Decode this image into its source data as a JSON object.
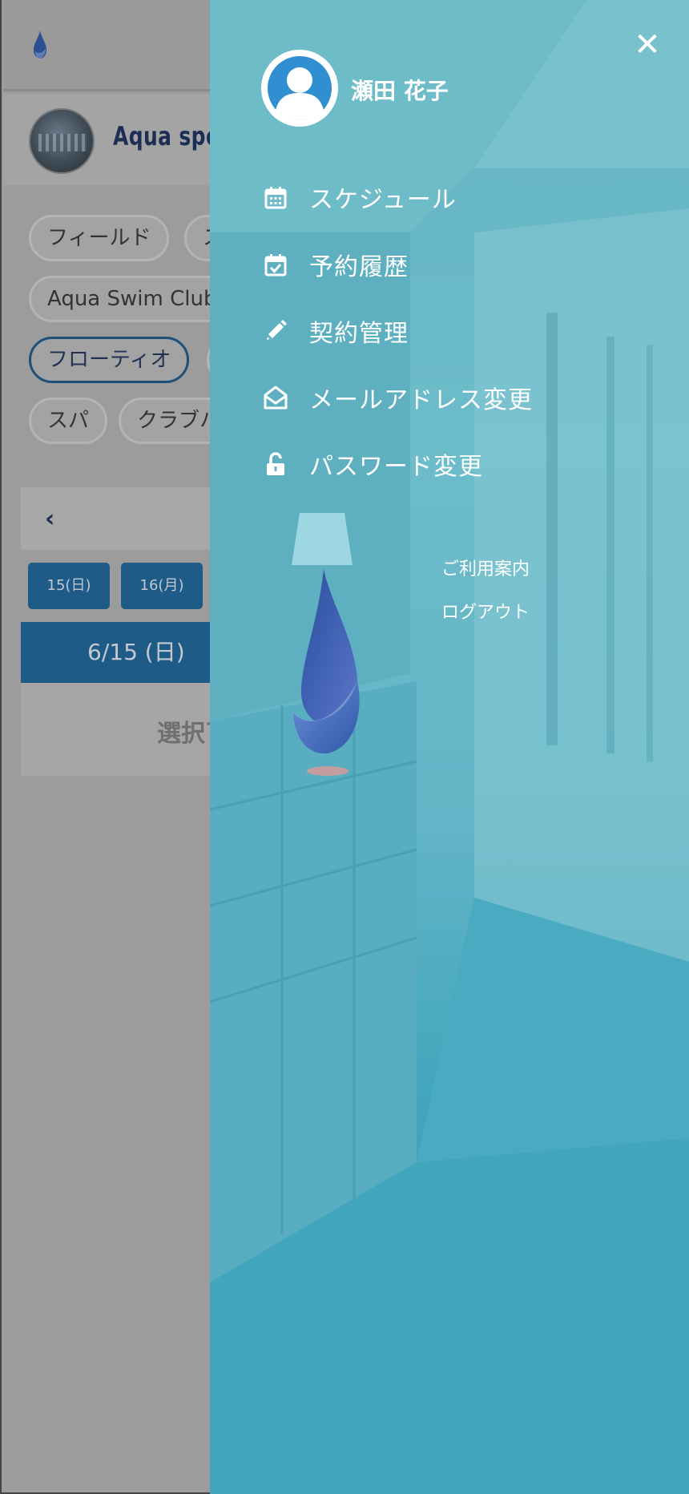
{
  "background_app": {
    "club": {
      "name": "Aqua spor"
    },
    "chips": [
      {
        "label": "フィールド"
      },
      {
        "label": "ス"
      },
      {
        "label": "Aqua Swim Club"
      },
      {
        "label": "フローティオ"
      },
      {
        "label": ""
      },
      {
        "label": "スパ"
      },
      {
        "label": "クラブハ"
      }
    ],
    "week_nav": {
      "prev_icon": "chevron-left-icon"
    },
    "days": [
      {
        "label": "15(日)"
      },
      {
        "label": "16(月)"
      }
    ],
    "selected_date": "6/15 (日)",
    "select_prompt": "選択了"
  },
  "drawer": {
    "user": {
      "name": "瀬田 花子",
      "avatar_icon": "user-icon"
    },
    "close_icon": "close-icon",
    "menu": [
      {
        "label": "スケジュール",
        "icon": "calendar-icon"
      },
      {
        "label": "予約履歴",
        "icon": "calendar-check-icon"
      },
      {
        "label": "契約管理",
        "icon": "pencil-icon"
      },
      {
        "label": "メールアドレス変更",
        "icon": "envelope-open-icon"
      },
      {
        "label": "パスワード変更",
        "icon": "unlock-icon"
      }
    ],
    "links": {
      "guide": "ご利用案内",
      "logout": "ログアウト"
    }
  },
  "colors": {
    "drawer_bg": "#64b3c3",
    "primary": "#1e5b87",
    "brand_navy": "#1d2e55",
    "avatar_blue": "#2f8fd0"
  }
}
